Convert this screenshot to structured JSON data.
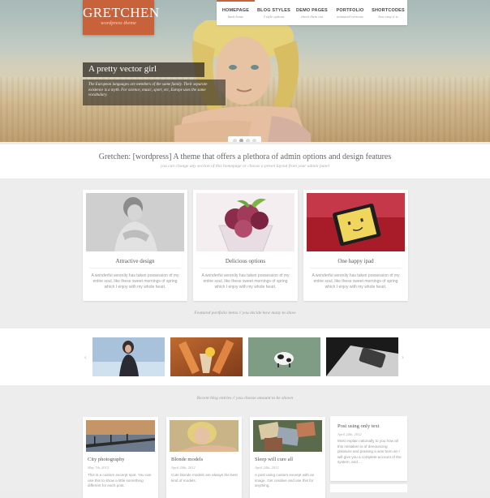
{
  "header": {
    "logo_title": "GRETCHEN",
    "logo_subtitle": "wordpress theme",
    "nav": [
      {
        "label": "HOMEPAGE",
        "sub": "back home"
      },
      {
        "label": "BLOG STYLES",
        "sub": "3 style options"
      },
      {
        "label": "DEMO PAGES",
        "sub": "check them out"
      },
      {
        "label": "PORTFOLIO",
        "sub": "animated versions"
      },
      {
        "label": "SHORTCODES",
        "sub": "how easy it is"
      }
    ]
  },
  "hero": {
    "caption": "A pretty vector girl",
    "description": "The European languages are members of the same family. Their separate existence is a myth. For science, music, sport, etc, Europe uses the same vocabulary."
  },
  "tagline": {
    "heading": "Gretchen: [wordpress] A theme that offers a plethora of admin options and design features",
    "sub": "you can change any section of this homepage or choose a preset layout from your admin panel"
  },
  "features": {
    "cards": [
      {
        "title": "Attractive design",
        "text": "A wonderful serenity has taken possession of my entire soul, like these sweet mornings of spring which I enjoy with my whole heart."
      },
      {
        "title": "Delicious options",
        "text": "A wonderful serenity has taken possession of my entire soul, like these sweet mornings of spring which I enjoy with my whole heart."
      },
      {
        "title": "One happy ipad",
        "text": "A wonderful serenity has taken possession of my entire soul, like these sweet mornings of spring which I enjoy with my whole heart."
      }
    ],
    "caption": "Featured portfolio items // you decide how many to show"
  },
  "portfolio": {
    "prev_icon": "chevron-left-icon",
    "next_icon": "chevron-right-icon",
    "prev": "‹",
    "next": "›"
  },
  "blog": {
    "caption": "Recent blog entries // you choose amount to be shown",
    "posts": [
      {
        "title": "City photography",
        "date": "May 7th, 2012",
        "excerpt": "This is a custom excerpt spot. You can use this to show a little something different for each post."
      },
      {
        "title": "Blonde models",
        "date": "April 24th, 2012",
        "excerpt": "Cute blonde models are always the best kind of models."
      },
      {
        "title": "Sleep will cure all",
        "date": "April 24th, 2012",
        "excerpt": "A post using custom excerpt with an image. Get creative and use this for anything."
      }
    ],
    "text_post": {
      "title": "Post using only text",
      "date": "April 24th, 2012",
      "excerpt": "Most explain rationally to you how all this mistaken is of denouncing pleasure and praising a was born an I will give you a complete account of the system, and ..."
    }
  }
}
